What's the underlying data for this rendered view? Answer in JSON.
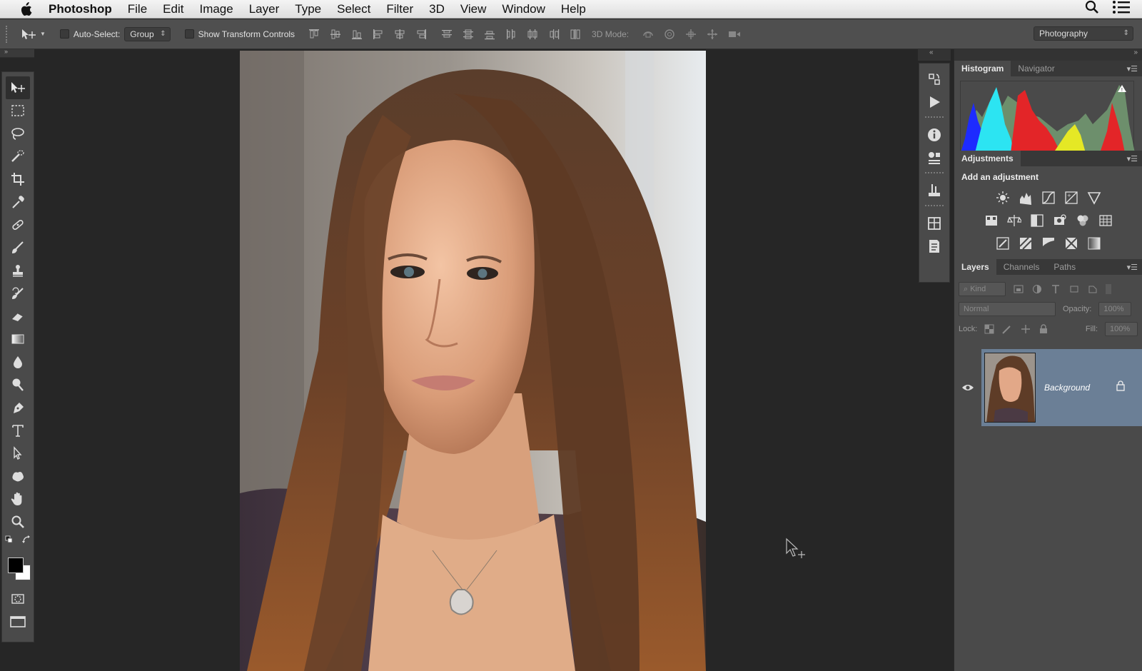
{
  "menubar": {
    "app_name": "Photoshop",
    "items": [
      "File",
      "Edit",
      "Image",
      "Layer",
      "Type",
      "Select",
      "Filter",
      "3D",
      "View",
      "Window",
      "Help"
    ]
  },
  "options": {
    "auto_select_label": "Auto-Select:",
    "auto_select_value": "Group",
    "show_transform_label": "Show Transform Controls",
    "mode_3d_label": "3D Mode:",
    "workspace_value": "Photography"
  },
  "panels": {
    "histogram_tabs": [
      "Histogram",
      "Navigator"
    ],
    "adjustments_tab": "Adjustments",
    "adjustments_title": "Add an adjustment",
    "layers_tabs": [
      "Layers",
      "Channels",
      "Paths"
    ],
    "kind_value": "Kind",
    "blend_mode": "Normal",
    "opacity_label": "Opacity:",
    "opacity_value": "100%",
    "lock_label": "Lock:",
    "fill_label": "Fill:",
    "fill_value": "100%",
    "layer_name": "Background"
  },
  "colors": {
    "panel_bg": "#4a4a4a",
    "selected_layer": "#6b7f96",
    "foreground": "#000000",
    "background": "#ffffff"
  }
}
